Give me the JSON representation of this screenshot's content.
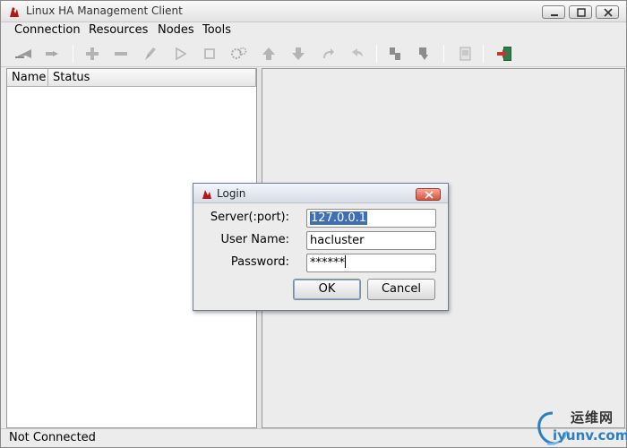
{
  "window": {
    "title": "Linux HA Management Client"
  },
  "menubar": {
    "items": [
      "Connection",
      "Resources",
      "Nodes",
      "Tools"
    ]
  },
  "toolbar": {
    "icons": [
      "connect-icon",
      "disconnect-icon",
      "add-icon",
      "remove-icon",
      "clean-icon",
      "start-icon",
      "stop-icon",
      "settings-icon",
      "move-up-icon",
      "move-down-icon",
      "redo-icon",
      "undo-icon",
      "standby-node-icon",
      "active-node-icon",
      "document-icon",
      "exit-icon"
    ]
  },
  "tree": {
    "columns": [
      "Name",
      "Status"
    ]
  },
  "status": {
    "text": "Not Connected"
  },
  "dialog": {
    "title": "Login",
    "server_label": "Server(:port):",
    "server_value": "127.0.0.1",
    "user_label": "User Name:",
    "user_value": "hacluster",
    "password_label": "Password:",
    "password_value": "******",
    "ok_label": "OK",
    "cancel_label": "Cancel"
  },
  "watermark": {
    "site_name": "运维网",
    "url": "iyunv.com"
  },
  "colors": {
    "selection": "#3f6fb5",
    "close_button": "#d6523d",
    "exit_icon": "#c0392b",
    "watermark": "#2a7fc4"
  }
}
